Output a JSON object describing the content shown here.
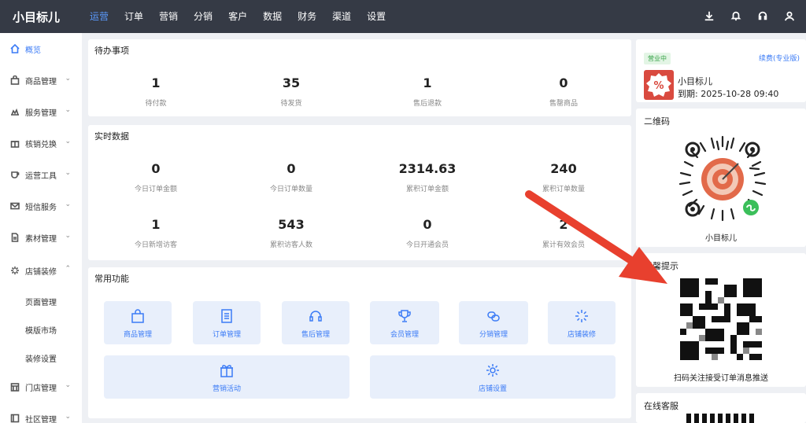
{
  "brand": "小目标儿",
  "topnav": [
    "运营",
    "订单",
    "营销",
    "分销",
    "客户",
    "数据",
    "财务",
    "渠道",
    "设置"
  ],
  "topnav_active": "运营",
  "top_icons": [
    "download-icon",
    "bell-icon",
    "headset-icon",
    "user-icon"
  ],
  "sidebar": {
    "items": [
      {
        "label": "概览",
        "icon": "home-icon",
        "active": true
      },
      {
        "label": "商品管理",
        "icon": "bag-icon"
      },
      {
        "label": "服务管理",
        "icon": "service-icon"
      },
      {
        "label": "核销兑换",
        "icon": "gift-icon"
      },
      {
        "label": "运营工具",
        "icon": "cup-icon"
      },
      {
        "label": "短信服务",
        "icon": "mail-icon"
      },
      {
        "label": "素材管理",
        "icon": "file-icon"
      },
      {
        "label": "店铺装修",
        "icon": "spark-icon",
        "expanded": true
      },
      {
        "label": "门店管理",
        "icon": "store-icon"
      },
      {
        "label": "社区管理",
        "icon": "community-icon"
      }
    ],
    "subitems": [
      "页面管理",
      "模版市场",
      "装修设置"
    ]
  },
  "todo": {
    "title": "待办事项",
    "stats": [
      {
        "value": "1",
        "label": "待付款"
      },
      {
        "value": "35",
        "label": "待发货"
      },
      {
        "value": "1",
        "label": "售后退款"
      },
      {
        "value": "0",
        "label": "售罄商品"
      }
    ]
  },
  "realtime": {
    "title": "实时数据",
    "row1": [
      {
        "value": "0",
        "label": "今日订单金额"
      },
      {
        "value": "0",
        "label": "今日订单数量"
      },
      {
        "value": "2314.63",
        "label": "累积订单金额"
      },
      {
        "value": "240",
        "label": "累积订单数量"
      }
    ],
    "row2": [
      {
        "value": "1",
        "label": "今日新增访客"
      },
      {
        "value": "543",
        "label": "累积访客人数"
      },
      {
        "value": "0",
        "label": "今日开通会员"
      },
      {
        "value": "2",
        "label": "累计有效会员"
      }
    ]
  },
  "functions": {
    "title": "常用功能",
    "row1": [
      {
        "label": "商品管理",
        "icon": "bag-icon"
      },
      {
        "label": "订单管理",
        "icon": "order-icon"
      },
      {
        "label": "售后管理",
        "icon": "headset-icon"
      },
      {
        "label": "会员管理",
        "icon": "trophy-icon"
      },
      {
        "label": "分销管理",
        "icon": "link-icon"
      },
      {
        "label": "店铺装修",
        "icon": "spark-icon"
      }
    ],
    "row2": [
      {
        "label": "营销活动",
        "icon": "gift-icon"
      },
      {
        "label": "店铺设置",
        "icon": "gear-icon"
      }
    ]
  },
  "store": {
    "badge": "营业中",
    "renew": "续费(专业版)",
    "name": "小目标儿",
    "expiry": "到期: 2025-10-28 09:40"
  },
  "qrcode": {
    "title": "二维码",
    "name": "小目标儿"
  },
  "reminder": {
    "title": "温馨提示",
    "caption": "扫码关注接受订单消息推送"
  },
  "support": {
    "title": "在线客服"
  },
  "colors": {
    "accent": "#3b7bf6",
    "topbar": "#353a45",
    "arrow": "#e8402e"
  }
}
